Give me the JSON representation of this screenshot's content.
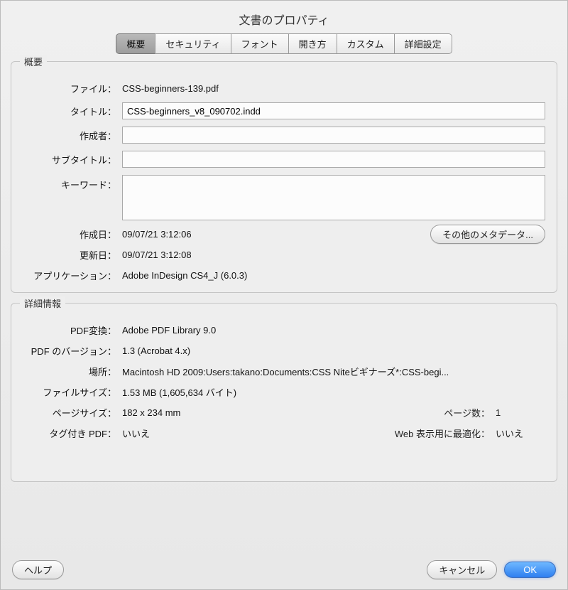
{
  "title": "文書のプロパティ",
  "tabs": {
    "overview": "概要",
    "security": "セキュリティ",
    "font": "フォント",
    "open": "開き方",
    "custom": "カスタム",
    "advanced": "詳細設定"
  },
  "group1": {
    "title": "概要",
    "file_label": "ファイル：",
    "file_value": "CSS-beginners-139.pdf",
    "title_label": "タイトル：",
    "title_value": "CSS-beginners_v8_090702.indd",
    "author_label": "作成者：",
    "author_value": "",
    "subtitle_label": "サブタイトル：",
    "subtitle_value": "",
    "keywords_label": "キーワード：",
    "keywords_value": "",
    "created_label": "作成日：",
    "created_value": "09/07/21 3:12:06",
    "modified_label": "更新日：",
    "modified_value": "09/07/21 3:12:08",
    "app_label": "アプリケーション：",
    "app_value": "Adobe InDesign CS4_J (6.0.3)",
    "more_meta": "その他のメタデータ..."
  },
  "group2": {
    "title": "詳細情報",
    "producer_label": "PDF変換：",
    "producer_value": "Adobe PDF Library 9.0",
    "version_label": "PDF のバージョン：",
    "version_value": "1.3 (Acrobat 4.x)",
    "location_label": "場所：",
    "location_value": "Macintosh HD 2009:Users:takano:Documents:CSS Niteビギナーズ*:CSS-begi...",
    "filesize_label": "ファイルサイズ：",
    "filesize_value": "1.53 MB (1,605,634 バイト)",
    "pagesize_label": "ページサイズ：",
    "pagesize_value": "182 x 234 mm",
    "pagecount_label": "ページ数：",
    "pagecount_value": "1",
    "tagged_label": "タグ付き PDF：",
    "tagged_value": "いいえ",
    "fastweb_label": "Web 表示用に最適化：",
    "fastweb_value": "いいえ"
  },
  "footer": {
    "help": "ヘルプ",
    "cancel": "キャンセル",
    "ok": "OK"
  }
}
